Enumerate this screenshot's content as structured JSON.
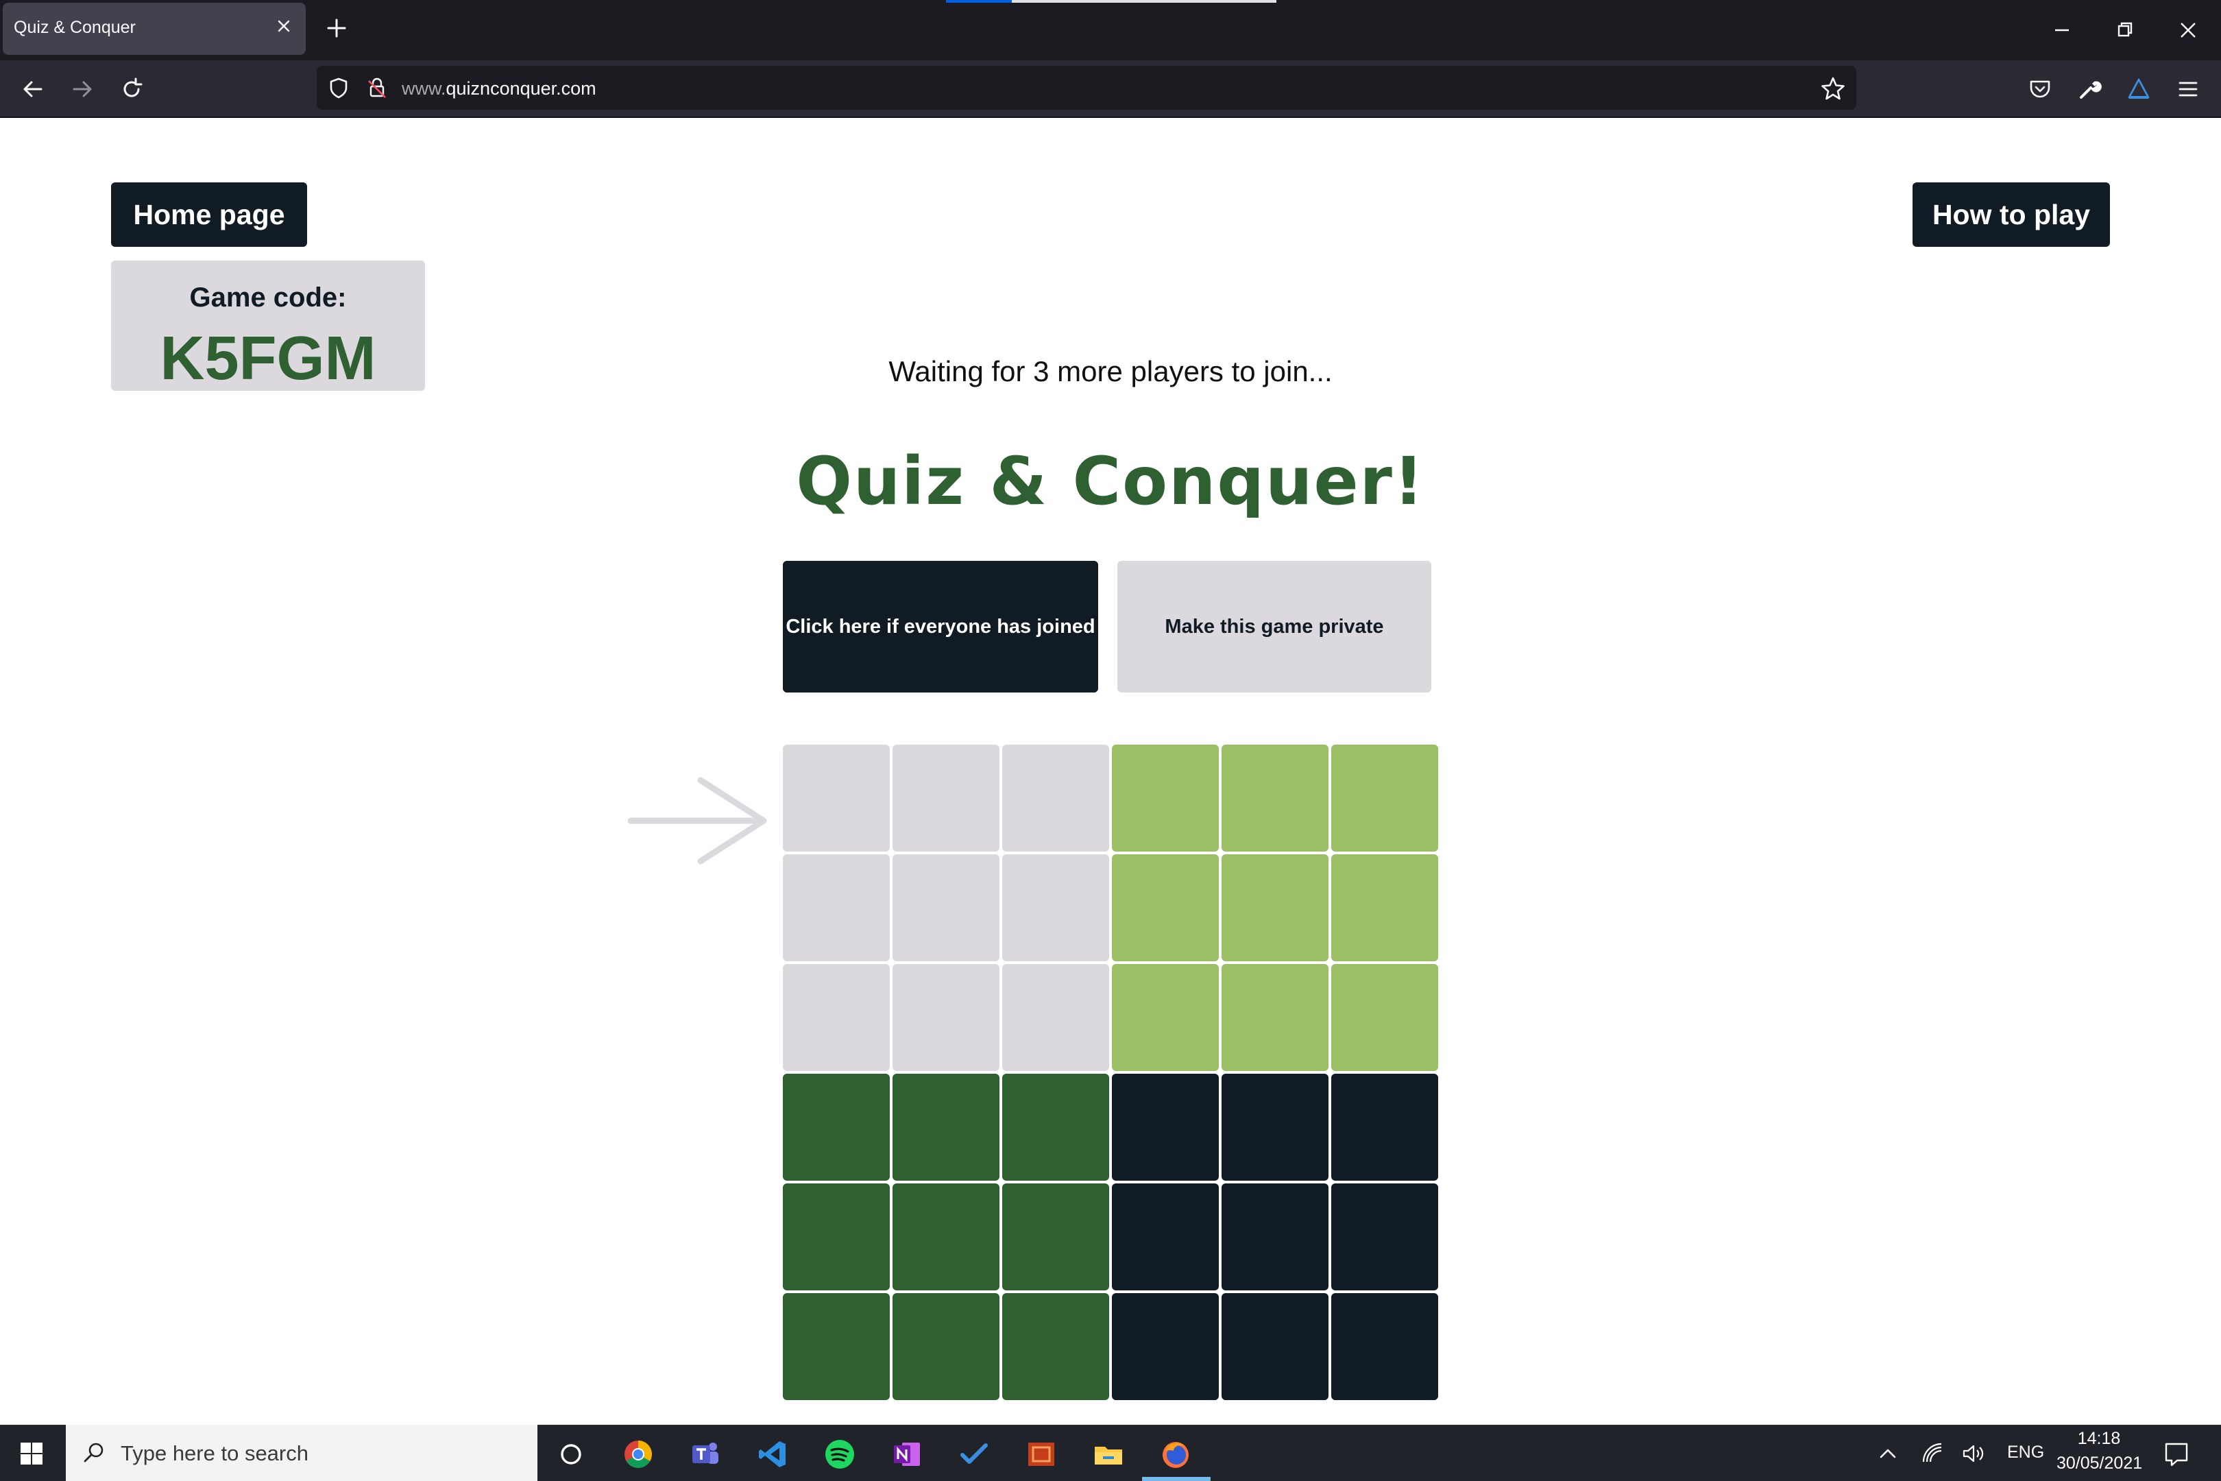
{
  "browser": {
    "tab_title": "Quiz & Conquer",
    "url_prefix": "www.",
    "url_domain": "quiznconquer.com"
  },
  "page": {
    "home_label": "Home page",
    "howto_label": "How to play",
    "game_code_label": "Game code:",
    "game_code": "K5FGM",
    "waiting_text": "Waiting for 3 more players to join...",
    "title": "Quiz & Conquer!",
    "start_label": "Click here if everyone has joined",
    "private_label": "Make this game private"
  },
  "board": {
    "size": 6,
    "colors": {
      "grey": "#dcd9de",
      "light_green": "#9abf64",
      "dark_green": "#2f6031",
      "navy": "#101b23"
    },
    "rows": [
      [
        "grey",
        "grey",
        "grey",
        "light_green",
        "light_green",
        "light_green"
      ],
      [
        "grey",
        "grey",
        "grey",
        "light_green",
        "light_green",
        "light_green"
      ],
      [
        "grey",
        "grey",
        "grey",
        "light_green",
        "light_green",
        "light_green"
      ],
      [
        "dark_green",
        "dark_green",
        "dark_green",
        "navy",
        "navy",
        "navy"
      ],
      [
        "dark_green",
        "dark_green",
        "dark_green",
        "navy",
        "navy",
        "navy"
      ],
      [
        "dark_green",
        "dark_green",
        "dark_green",
        "navy",
        "navy",
        "navy"
      ]
    ],
    "turn_indicator_color": "#dcd9de"
  },
  "taskbar": {
    "search_placeholder": "Type here to search",
    "apps": [
      "cortana-icon",
      "chrome-icon",
      "teams-icon",
      "vscode-icon",
      "spotify-icon",
      "onenote-icon",
      "todo-icon",
      "powerpoint-icon",
      "file-explorer-icon",
      "firefox-icon"
    ],
    "language": "ENG",
    "time": "14:18",
    "date": "30/05/2021"
  }
}
